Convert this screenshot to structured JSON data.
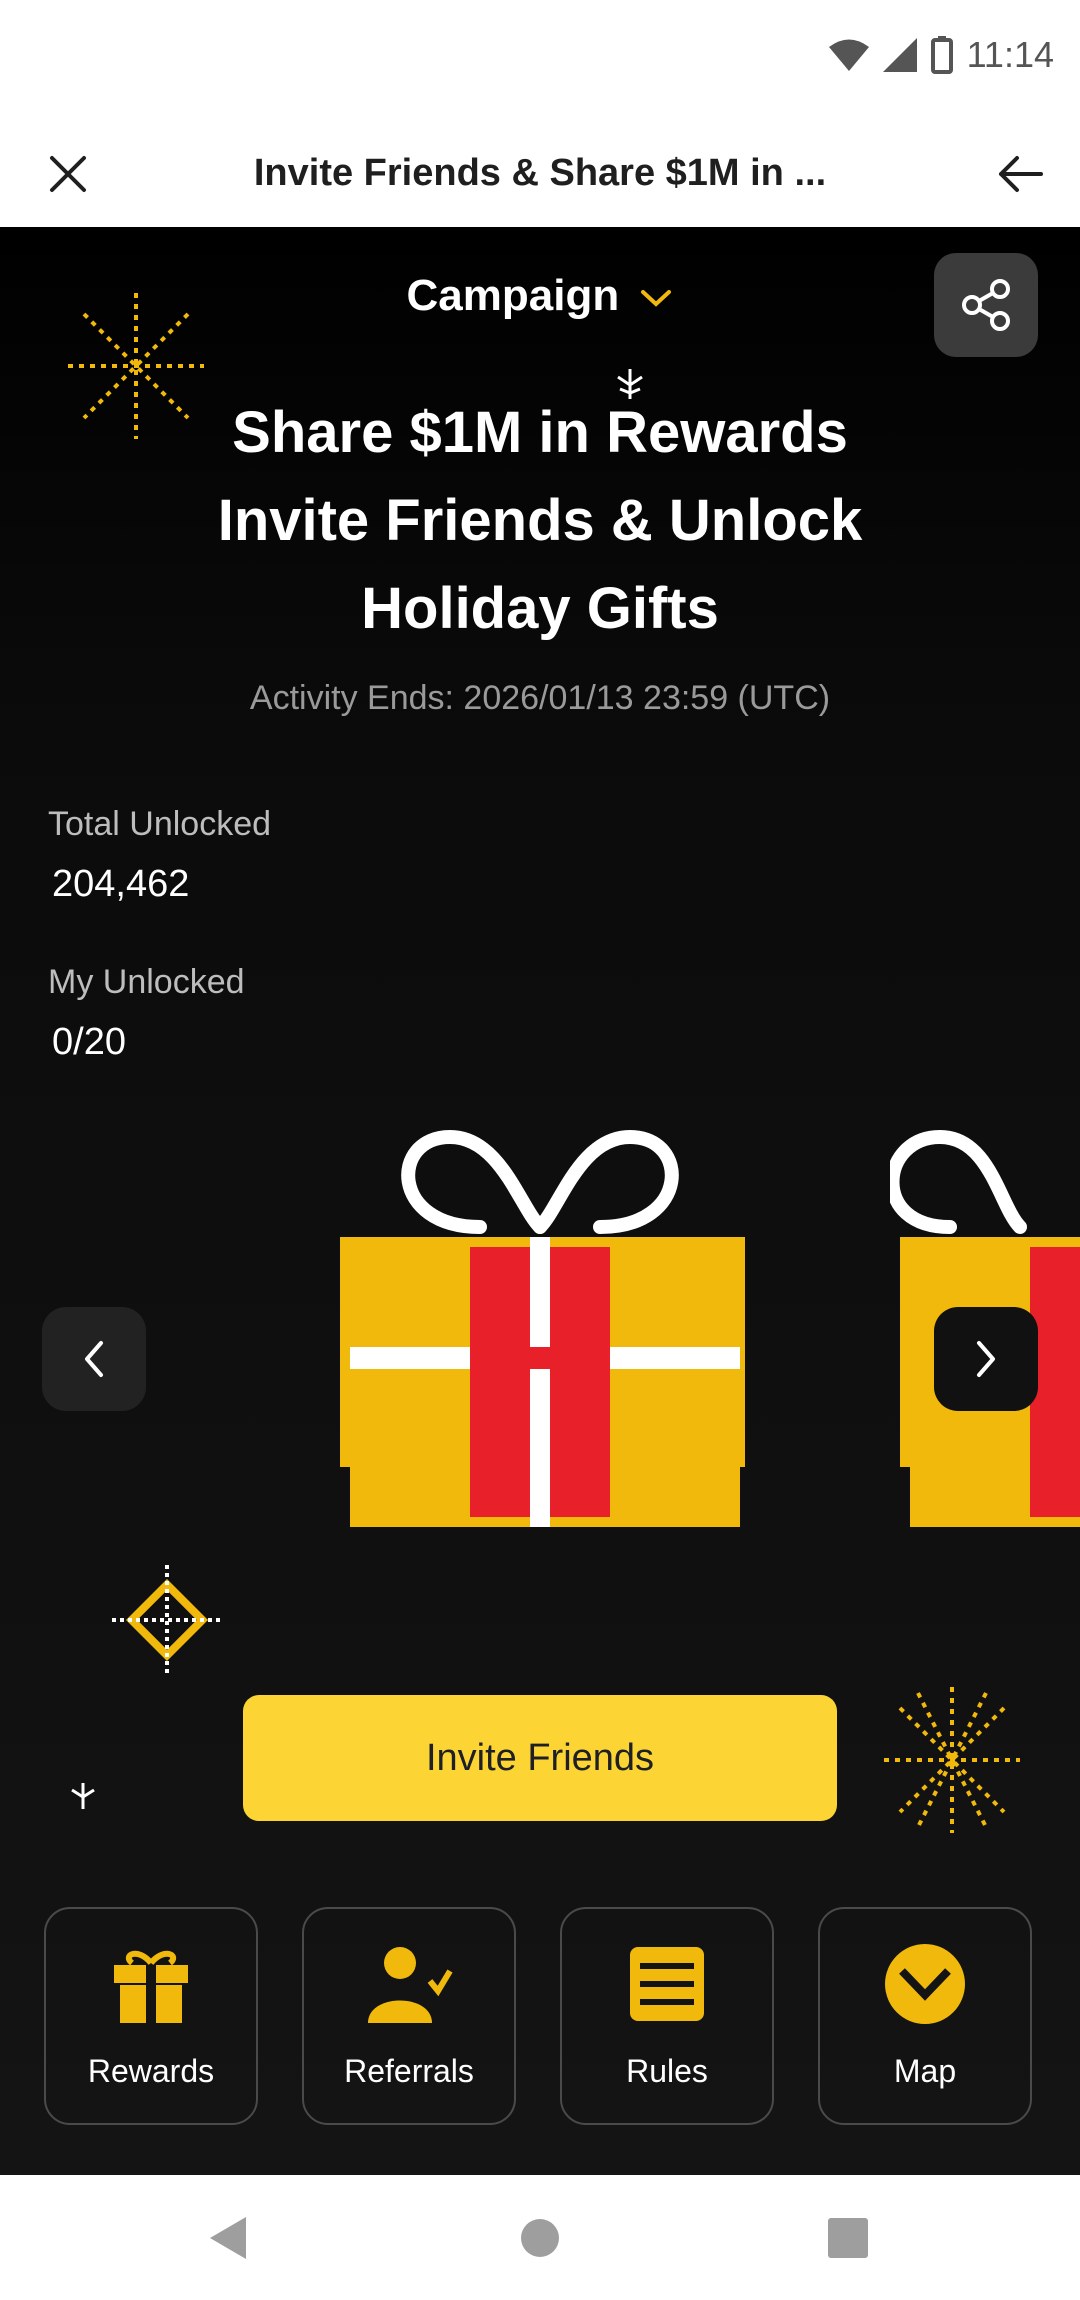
{
  "status_bar": {
    "time": "11:14",
    "icons": [
      "wifi-icon",
      "signal-icon",
      "battery-icon"
    ]
  },
  "header": {
    "title": "Invite Friends & Share $1M in ...",
    "close_icon": "close-icon",
    "back_icon": "arrow-left-icon"
  },
  "campaign": {
    "label": "Campaign",
    "accent": "#f0b90b"
  },
  "headline": {
    "line1": "Share $1M in Rewards",
    "line2": "Invite Friends & Unlock",
    "line3": "Holiday Gifts"
  },
  "activity_ends": "Activity Ends: 2026/01/13 23:59 (UTC)",
  "stats": {
    "total_label": "Total Unlocked",
    "total_value": "204,462",
    "mine_label": "My Unlocked",
    "mine_value": "0/20"
  },
  "carousel": {
    "prev_icon": "chevron-left-icon",
    "next_icon": "chevron-right-icon"
  },
  "invite_button": "Invite Friends",
  "tiles": [
    {
      "label": "Rewards",
      "icon": "gift-icon"
    },
    {
      "label": "Referrals",
      "icon": "people-icon"
    },
    {
      "label": "Rules",
      "icon": "document-icon"
    },
    {
      "label": "Map",
      "icon": "map-icon"
    }
  ],
  "colors": {
    "yellow": "#fcd535",
    "gold": "#f0b90b",
    "red": "#e8202a",
    "background": "#000000"
  }
}
